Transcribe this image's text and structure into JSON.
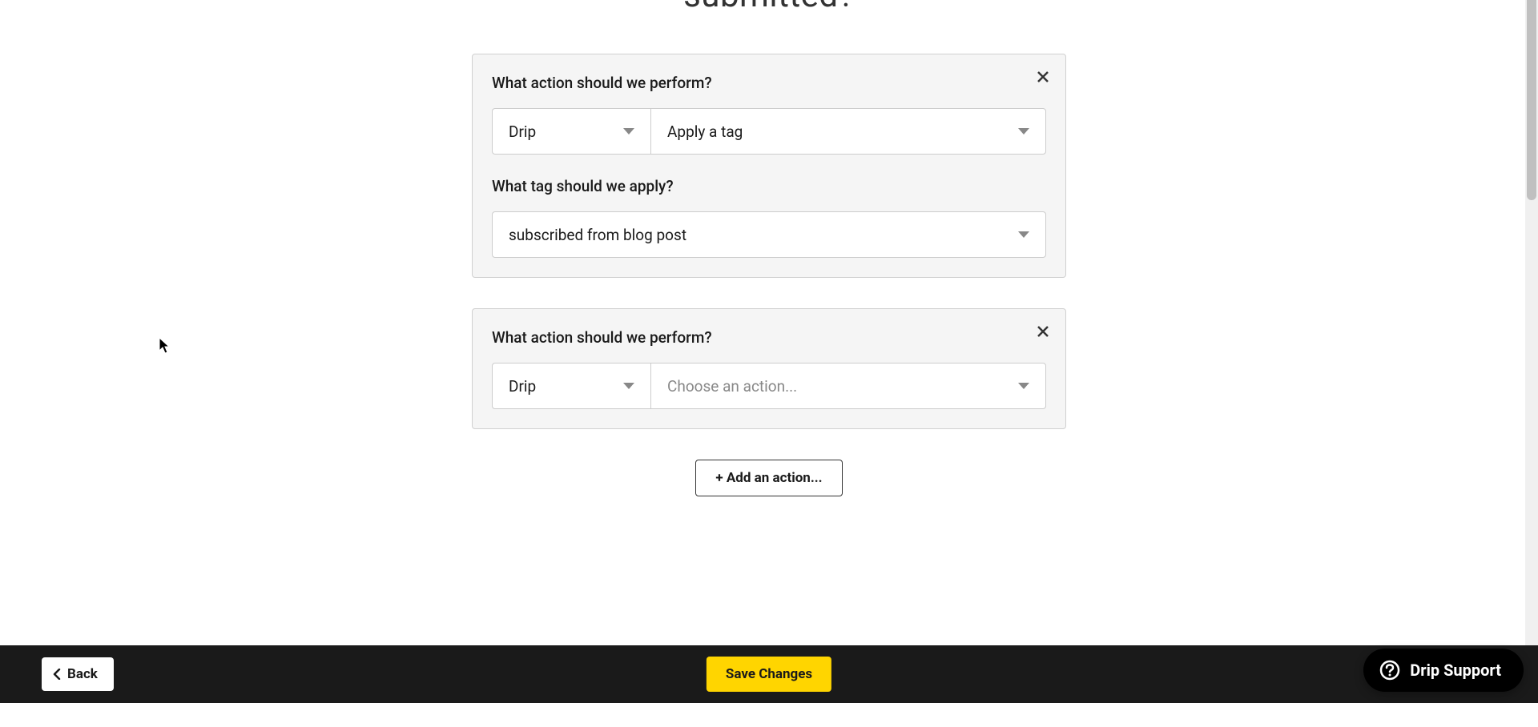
{
  "page_title_fragment": "submitted?",
  "cards": [
    {
      "action_label": "What action should we perform?",
      "provider_value": "Drip",
      "action_value": "Apply a tag",
      "tag_label": "What tag should we apply?",
      "tag_value": "subscribed from blog post"
    },
    {
      "action_label": "What action should we perform?",
      "provider_value": "Drip",
      "action_placeholder": "Choose an action..."
    }
  ],
  "add_action_label": "+ Add an action...",
  "footer": {
    "back_label": "Back",
    "save_label": "Save Changes"
  },
  "support_label": "Drip Support"
}
